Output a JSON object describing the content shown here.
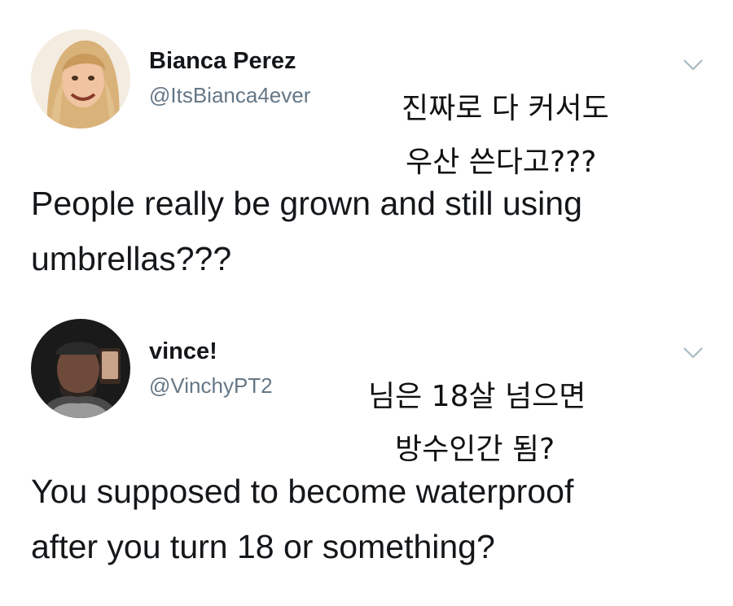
{
  "tweets": [
    {
      "display_name": "Bianca Perez",
      "handle": "@ItsBianca4ever",
      "caption_line1": "진짜로 다 커서도",
      "caption_line2": "우산 쓴다고???",
      "text_line1": "People really be grown and still using",
      "text_line2": "umbrellas???",
      "menu_icon": "chevron-down-icon",
      "avatar_icon": "profile-photo"
    },
    {
      "display_name": "vince!",
      "handle": "@VinchyPT2",
      "caption_line1": "님은 18살 넘으면",
      "caption_line2": "방수인간 됨?",
      "text_line1": "You supposed to become waterproof",
      "text_line2": "after you turn 18 or something?",
      "menu_icon": "chevron-down-icon",
      "avatar_icon": "profile-photo"
    }
  ],
  "colors": {
    "name": "#14171a",
    "handle": "#657786",
    "chevron": "#aab8c2"
  }
}
